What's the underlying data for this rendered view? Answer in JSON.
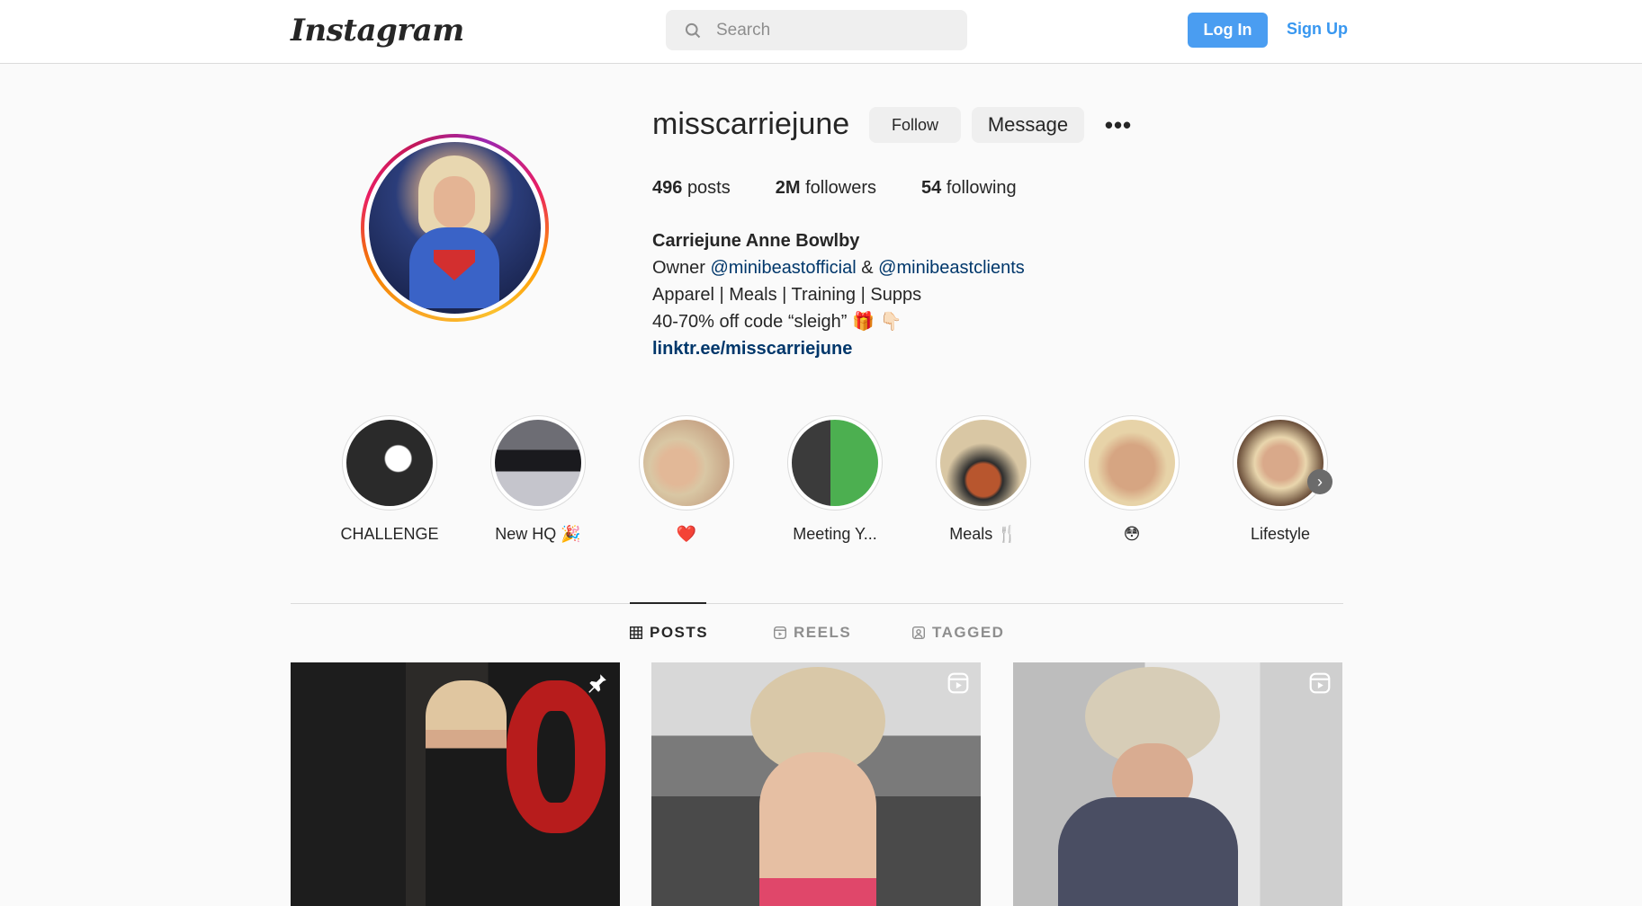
{
  "header": {
    "logo_text": "Instagram",
    "search_placeholder": "Search",
    "login_label": "Log In",
    "signup_label": "Sign Up"
  },
  "profile": {
    "username": "misscarriejune",
    "follow_label": "Follow",
    "message_label": "Message",
    "more_label": "•••",
    "stats": {
      "posts_count": "496",
      "posts_label": "posts",
      "followers_count": "2M",
      "followers_label": "followers",
      "following_count": "54",
      "following_label": "following"
    },
    "bio": {
      "full_name": "Carriejune Anne Bowlby",
      "owner_prefix": "Owner",
      "mention1": "@minibeastofficial",
      "amp": "&",
      "mention2": "@minibeastclients",
      "line3": "Apparel | Meals | Training | Supps",
      "line4": "40-70% off code “sleigh” 🎁 👇🏻",
      "link": "linktr.ee/misscarriejune"
    }
  },
  "highlights": [
    {
      "label": "CHALLENGE",
      "color": "#2a2a2a"
    },
    {
      "label": "New HQ 🎉",
      "color": "#4b4b52"
    },
    {
      "label": "❤️",
      "color": "#c8a788"
    },
    {
      "label": "Meeting Y...",
      "color": "#5aa86a"
    },
    {
      "label": "Meals 🍴",
      "color": "#b07a58"
    },
    {
      "label": "😳",
      "color": "#d6a582"
    },
    {
      "label": "Lifestyle",
      "color": "#8a6a4e"
    }
  ],
  "tabs": [
    {
      "label": "POSTS",
      "icon": "grid-icon",
      "active": true
    },
    {
      "label": "REELS",
      "icon": "reels-icon",
      "active": false
    },
    {
      "label": "TAGGED",
      "icon": "tagged-icon",
      "active": false
    }
  ],
  "posts": [
    {
      "type": "pinned",
      "icon": "pin-icon"
    },
    {
      "type": "reel",
      "icon": "reel-icon"
    },
    {
      "type": "reel",
      "icon": "reel-icon"
    }
  ],
  "colors": {
    "accent": "#4a9df1",
    "link": "#00376b",
    "border": "#dbdbdb"
  }
}
